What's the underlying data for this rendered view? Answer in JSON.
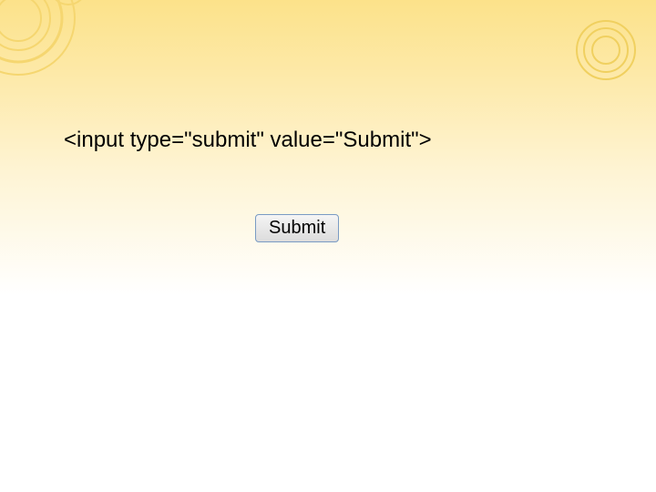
{
  "slide": {
    "code_snippet": "<input type=\"submit\" value=\"Submit\">",
    "button_label": "Submit"
  }
}
